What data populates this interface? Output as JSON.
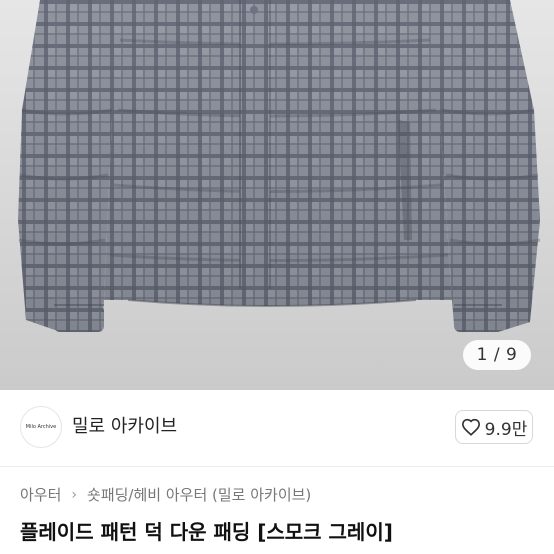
{
  "gallery": {
    "counter_current": "1",
    "counter_total": "9",
    "counter_text": "1 / 9"
  },
  "seller": {
    "avatar_text": "Milo Archive",
    "name": "밀로 아카이브"
  },
  "like": {
    "icon": "heart-icon",
    "count": "9.9만"
  },
  "breadcrumb": {
    "items": [
      "아우터",
      "숏패딩/헤비 아우터 (밀로 아카이브)"
    ],
    "separator_icon": "chevron-right-icon"
  },
  "product": {
    "title": "플레이드 패턴 덕 다운 패딩 [스모크 그레이]"
  },
  "colors": {
    "jacket_base": "#8e939e",
    "jacket_check": "#5b5f6c",
    "background": "#e6e6e6"
  }
}
